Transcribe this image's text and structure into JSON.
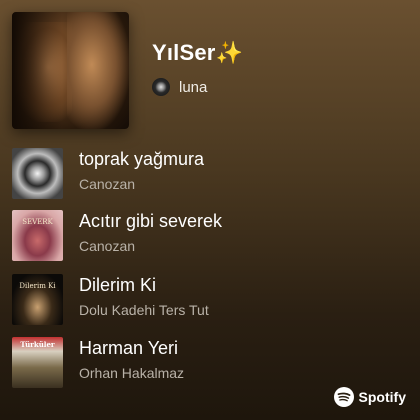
{
  "playlist": {
    "title": "YılSer✨",
    "owner": "luna"
  },
  "tracks": [
    {
      "name": "toprak yağmura",
      "artist": "Canozan",
      "cover_text": ""
    },
    {
      "name": "Acıtır gibi severek",
      "artist": "Canozan",
      "cover_text": "SEVERK"
    },
    {
      "name": "Dilerim Ki",
      "artist": "Dolu Kadehi Ters Tut",
      "cover_text": "Dilerim Ki"
    },
    {
      "name": "Harman Yeri",
      "artist": "Orhan Hakalmaz",
      "cover_text": "Türküler"
    }
  ],
  "branding": {
    "label": "Spotify",
    "icon": "spotify-icon",
    "color": "#ffffff"
  },
  "theme": {
    "background_top": "#6a5030",
    "background_bottom": "#1e160c",
    "secondary_text": "#b9b2a8"
  }
}
